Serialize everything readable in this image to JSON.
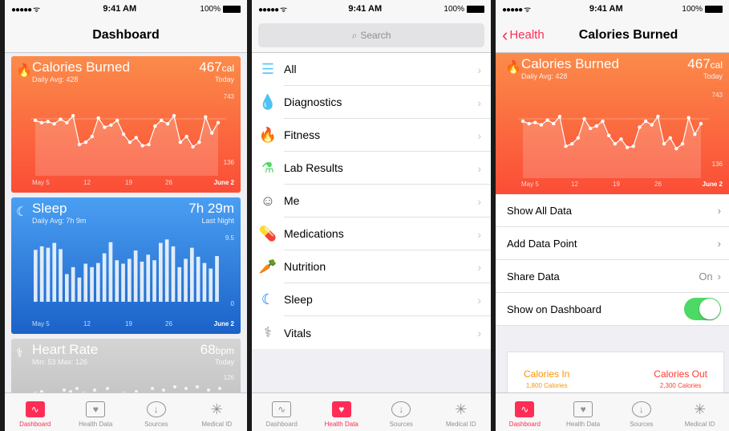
{
  "status": {
    "time": "9:41 AM",
    "battery": "100%",
    "signal": "●●●●● ᯤ"
  },
  "dashboard": {
    "title": "Dashboard",
    "calories": {
      "title": "Calories Burned",
      "sub": "Daily Avg: 428",
      "value": "467",
      "unit": "cal",
      "when": "Today",
      "ymax": "743",
      "ymin": "136"
    },
    "sleep": {
      "title": "Sleep",
      "sub": "Daily Avg: 7h 9m",
      "value": "7h 29m",
      "when": "Last Night",
      "ymax": "9.5",
      "ymin": "0"
    },
    "heart": {
      "title": "Heart Rate",
      "sub": "Min: 53 Max: 126",
      "value": "68",
      "unit": "bpm",
      "when": "Today",
      "ymax": "126"
    },
    "xlabels": [
      "May 5",
      "12",
      "19",
      "26",
      "June 2"
    ]
  },
  "chart_data": [
    {
      "type": "line",
      "title": "Calories Burned",
      "ylim": [
        136,
        743
      ],
      "values": [
        520,
        500,
        510,
        490,
        530,
        500,
        560,
        310,
        330,
        380,
        540,
        460,
        480,
        520,
        400,
        330,
        370,
        300,
        310,
        470,
        520,
        490,
        560,
        330,
        380,
        290,
        330,
        550,
        410,
        500
      ]
    },
    {
      "type": "bar",
      "title": "Sleep",
      "ylim": [
        0,
        9.5
      ],
      "values": [
        7.5,
        8,
        7.8,
        8.5,
        7.6,
        4,
        5,
        3.5,
        5.5,
        5,
        5.6,
        7,
        8.6,
        6,
        5.5,
        6.2,
        7.4,
        5.8,
        6.8,
        6,
        8.5,
        9,
        8,
        5,
        6.2,
        7.8,
        6.5,
        5.6,
        4.8,
        6.6
      ]
    }
  ],
  "tabs": [
    "Dashboard",
    "Health Data",
    "Sources",
    "Medical ID"
  ],
  "healthdata": {
    "search_placeholder": "Search",
    "items": [
      "All",
      "Diagnostics",
      "Fitness",
      "Lab Results",
      "Me",
      "Medications",
      "Nutrition",
      "Sleep",
      "Vitals"
    ]
  },
  "detail": {
    "back": "Health",
    "title": "Calories Burned",
    "rows": [
      "Show All Data",
      "Add Data Point",
      "Share Data",
      "Show on Dashboard"
    ],
    "share_value": "On",
    "calories_in": {
      "label": "Calories In",
      "value": "1,800 Calories"
    },
    "calories_out": {
      "label": "Calories Out",
      "value": "2,300 Calories"
    }
  },
  "colors": {
    "accent": "#ff2d55",
    "orange": "#fb6a3f",
    "blue": "#2f80e0",
    "green": "#4cd964"
  }
}
